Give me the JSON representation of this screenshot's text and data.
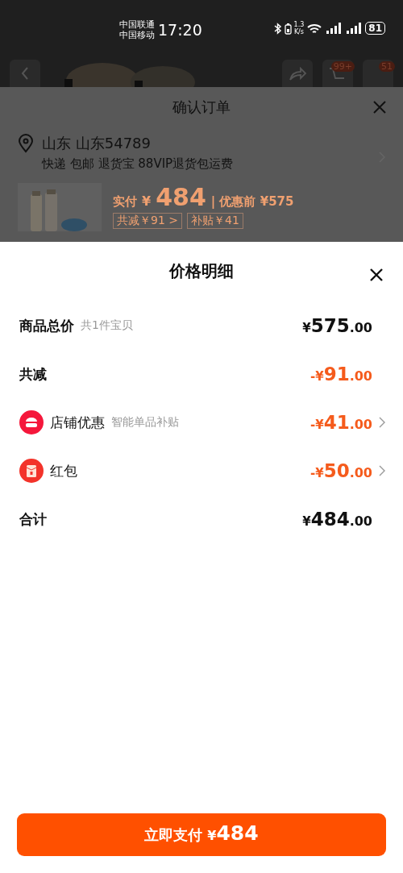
{
  "status_bar": {
    "carriers": [
      "中国联通",
      "中国移动"
    ],
    "time": "17:20",
    "speed": [
      "1.3",
      "K/s"
    ],
    "battery": "81"
  },
  "header": {
    "badges": [
      "99+",
      "51"
    ]
  },
  "order": {
    "title": "确认订单",
    "address": "山东 山东54789",
    "delivery": "快递 包邮 退货宝 88VIP退货包运费",
    "pay_label": "实付",
    "currency": "¥",
    "pay_amount": "484",
    "before_label": "| 优惠前 ¥575",
    "tags": [
      "共减￥91 >",
      "补贴￥41"
    ]
  },
  "sheet": {
    "title": "价格明细",
    "rows": [
      {
        "kind": "plain",
        "label": "商品总价",
        "note": "共1件宝贝",
        "sign": "¥",
        "integer": "575",
        "decimals": ".00",
        "discount": false,
        "chevron": false
      },
      {
        "kind": "plain",
        "label": "共减",
        "sign": "-¥",
        "integer": "91",
        "decimals": ".00",
        "discount": true,
        "chevron": false
      },
      {
        "kind": "shop",
        "label": "店铺优惠",
        "note": "智能单品补贴",
        "sign": "-¥",
        "integer": "41",
        "decimals": ".00",
        "discount": true,
        "chevron": true
      },
      {
        "kind": "redpacket",
        "label": "红包",
        "sign": "-¥",
        "integer": "50",
        "decimals": ".00",
        "discount": true,
        "chevron": true
      },
      {
        "kind": "plain",
        "label": "合计",
        "sign": "¥",
        "integer": "484",
        "decimals": ".00",
        "discount": false,
        "chevron": false
      }
    ],
    "pay_button": {
      "label": "立即支付",
      "sign": "¥",
      "amount": "484"
    }
  }
}
